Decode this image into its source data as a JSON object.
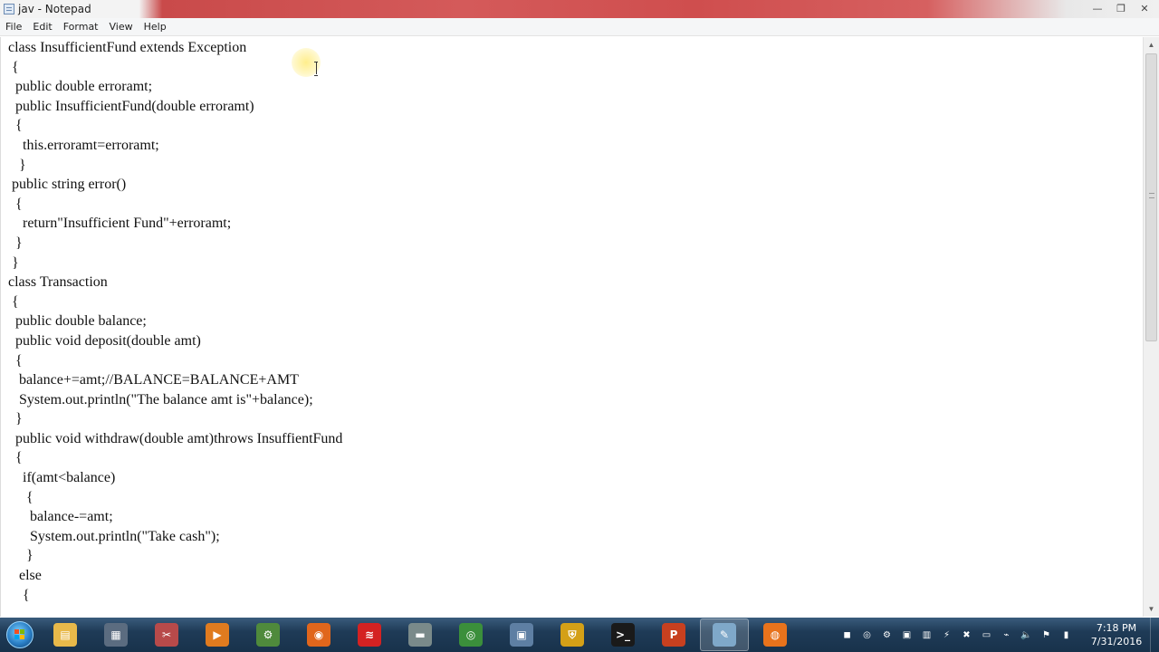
{
  "window": {
    "title": "jav - Notepad",
    "controls": {
      "minimize": "—",
      "maximize": "❐",
      "close": "✕"
    }
  },
  "menu": {
    "items": [
      "File",
      "Edit",
      "Format",
      "View",
      "Help"
    ]
  },
  "editor": {
    "lines": [
      "class InsufficientFund extends Exception",
      " {",
      "  public double erroramt;",
      "  public InsufficientFund(double erroramt)",
      "  {",
      "    this.erroramt=erroramt;",
      "   }",
      " public string error()",
      "  {",
      "    return\"Insufficient Fund\"+erroramt;",
      "  }",
      " }",
      "class Transaction",
      " {",
      "  public double balance;",
      "  public void deposit(double amt)",
      "  {",
      "   balance+=amt;//BALANCE=BALANCE+AMT",
      "   System.out.println(\"The balance amt is\"+balance);",
      "  }",
      "  public void withdraw(double amt)throws InsuffientFund",
      "  {",
      "    if(amt<balance)",
      "     {",
      "      balance-=amt;",
      "      System.out.println(\"Take cash\");",
      "     }",
      "   else",
      "    {"
    ]
  },
  "taskbar": {
    "apps": [
      {
        "name": "file-explorer-icon",
        "color": "#e8b94a",
        "glyph": "▤"
      },
      {
        "name": "calculator-icon",
        "color": "#5b6c80",
        "glyph": "▦"
      },
      {
        "name": "snipping-tool-icon",
        "color": "#b84a4a",
        "glyph": "✂"
      },
      {
        "name": "media-player-icon",
        "color": "#e07b1f",
        "glyph": "▶"
      },
      {
        "name": "tool-icon",
        "color": "#4f8a3c",
        "glyph": "⚙"
      },
      {
        "name": "firefox-icon",
        "color": "#e0661c",
        "glyph": "◉"
      },
      {
        "name": "aircel-icon",
        "color": "#d42222",
        "glyph": "≋"
      },
      {
        "name": "network-drive-icon",
        "color": "#7a8a8a",
        "glyph": "▬"
      },
      {
        "name": "chrome-icon",
        "color": "#3b8f3b",
        "glyph": "◎"
      },
      {
        "name": "window-icon",
        "color": "#5e7fa3",
        "glyph": "▣"
      },
      {
        "name": "shield-icon",
        "color": "#d4a017",
        "glyph": "⛨"
      },
      {
        "name": "command-prompt-icon",
        "color": "#1a1a1a",
        "glyph": ">_"
      },
      {
        "name": "powerpoint-icon",
        "color": "#c8401f",
        "glyph": "P"
      },
      {
        "name": "notepad-icon",
        "color": "#7fa8c9",
        "glyph": "✎"
      },
      {
        "name": "recorder-icon",
        "color": "#e8731c",
        "glyph": "◍"
      }
    ],
    "tray_icons": [
      {
        "name": "tray-recorder-icon",
        "glyph": "◼"
      },
      {
        "name": "tray-chrome-icon",
        "glyph": "◎"
      },
      {
        "name": "tray-tool-icon",
        "glyph": "⚙"
      },
      {
        "name": "tray-app-icon",
        "glyph": "▣"
      },
      {
        "name": "tray-chart-icon",
        "glyph": "▥"
      },
      {
        "name": "tray-network-icon",
        "glyph": "⚡"
      },
      {
        "name": "tray-security-icon",
        "glyph": "✖"
      },
      {
        "name": "tray-monitor-icon",
        "glyph": "▭"
      },
      {
        "name": "tray-usb-icon",
        "glyph": "⌁"
      },
      {
        "name": "tray-volume-icon",
        "glyph": "🔈"
      },
      {
        "name": "tray-alert-icon",
        "glyph": "⚑"
      },
      {
        "name": "tray-signal-icon",
        "glyph": "▮"
      }
    ],
    "clock": {
      "time": "7:18 PM",
      "date": "7/31/2016"
    }
  }
}
